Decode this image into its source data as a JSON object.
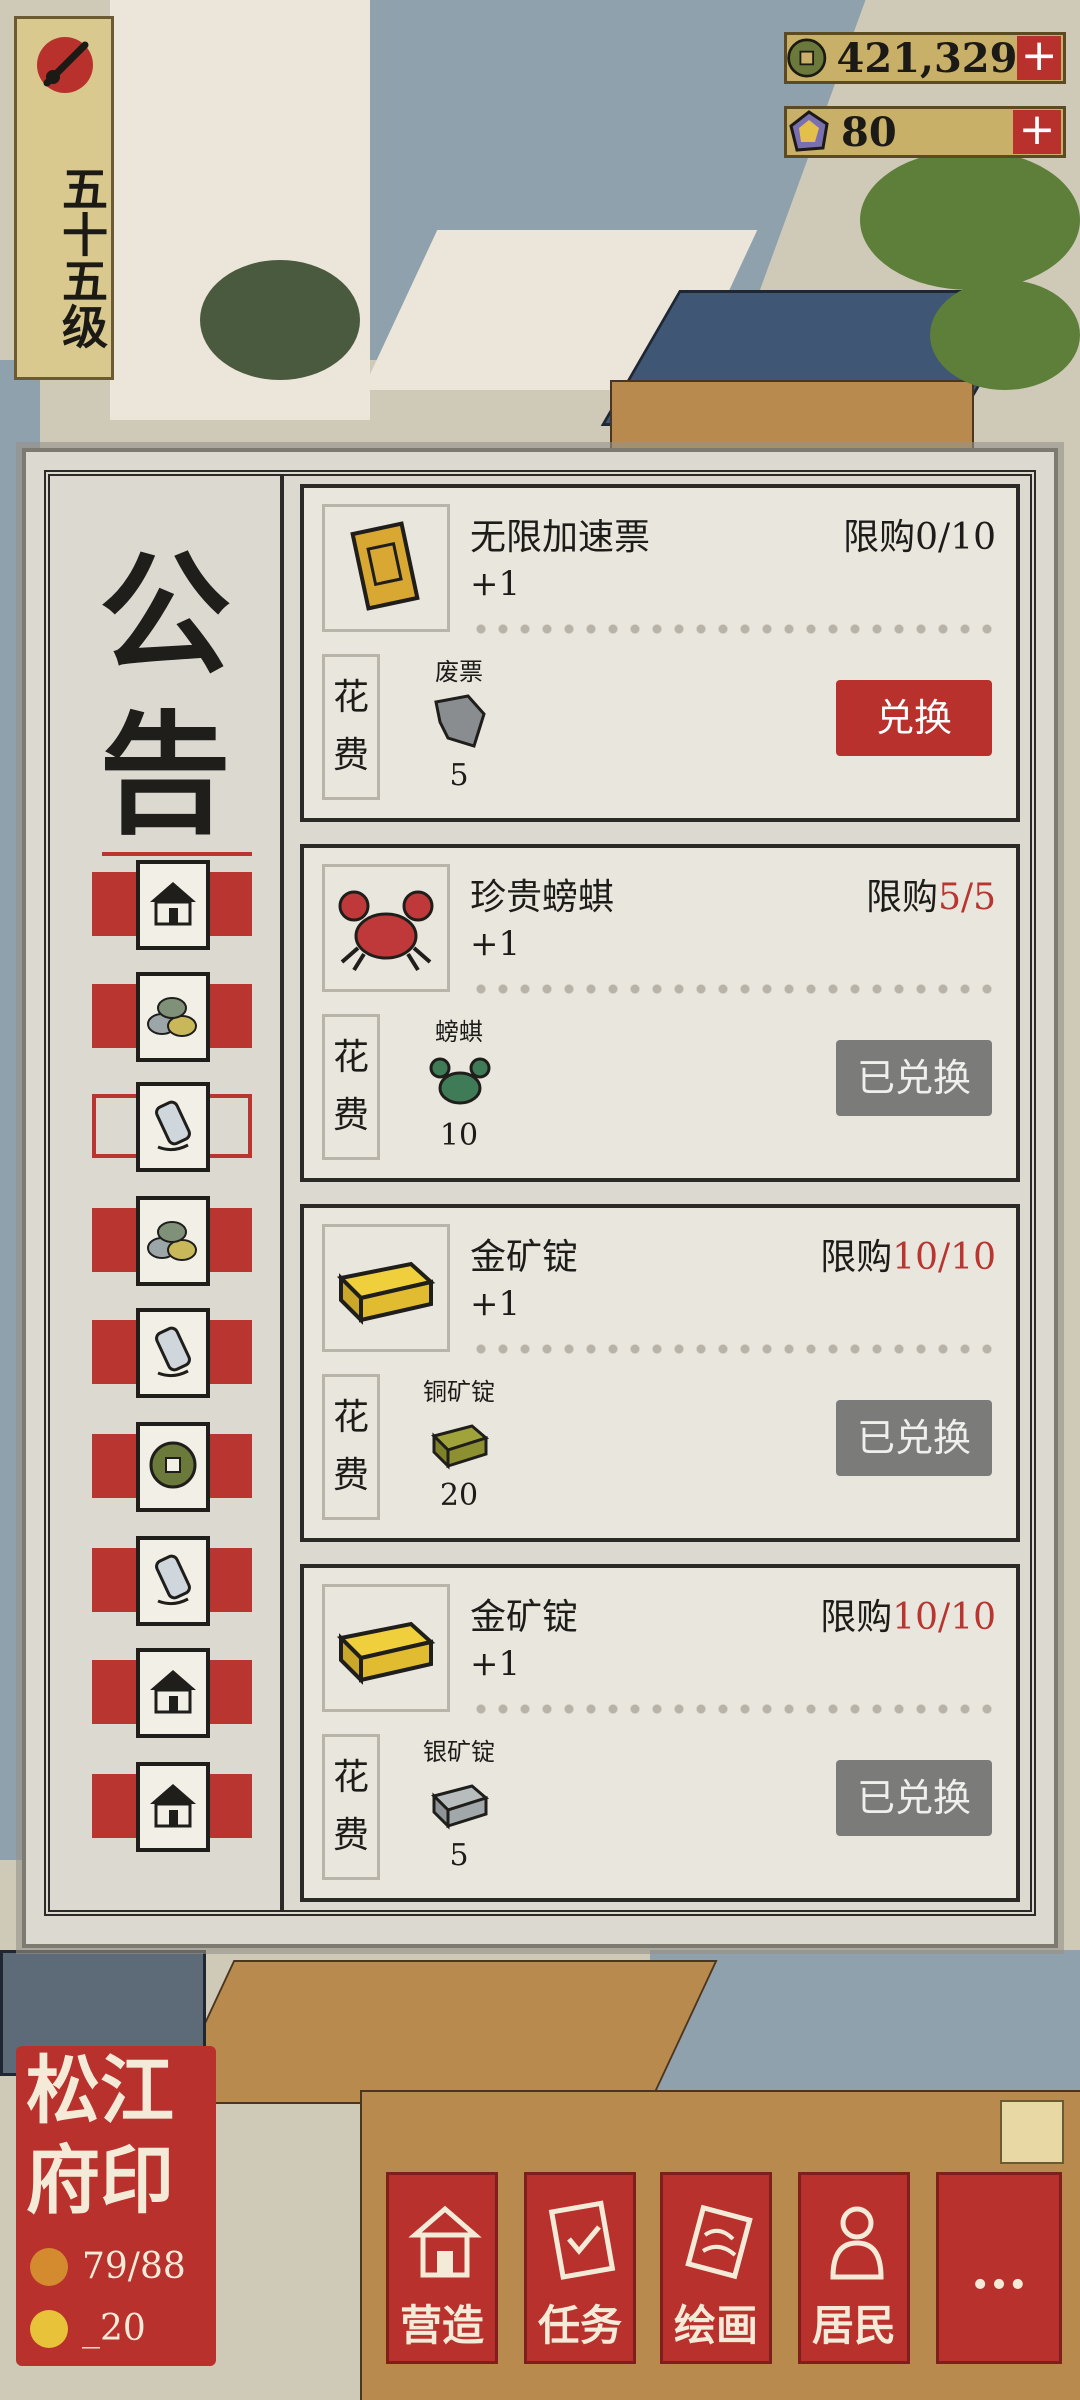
{
  "level": {
    "text": "五十五级"
  },
  "currency": [
    {
      "icon": "coin-icon",
      "value": "421,329"
    },
    {
      "icon": "jade-icon",
      "value": "80"
    }
  ],
  "panel": {
    "title": "公告"
  },
  "tabs": [
    {
      "icon": "house-icon",
      "selected": false
    },
    {
      "icon": "ore-pile-icon",
      "selected": false
    },
    {
      "icon": "bottle-icon",
      "selected": true
    },
    {
      "icon": "ore-pile-icon",
      "selected": false
    },
    {
      "icon": "bottle-icon",
      "selected": false
    },
    {
      "icon": "coin-icon",
      "selected": false
    },
    {
      "icon": "bottle-icon",
      "selected": false
    },
    {
      "icon": "house-icon",
      "selected": false
    },
    {
      "icon": "house-icon",
      "selected": false
    }
  ],
  "items": [
    {
      "name": "无限加速票",
      "amount": "+1",
      "limit_prefix": "限购",
      "limit_count": "0/10",
      "limit_red": false,
      "cost_label": "花费",
      "cost_name": "废票",
      "cost_num": "5",
      "button": "兑换",
      "button_active": true
    },
    {
      "name": "珍贵螃蜞",
      "amount": "+1",
      "limit_prefix": "限购",
      "limit_count": "5/5",
      "limit_red": true,
      "cost_label": "花费",
      "cost_name": "螃蜞",
      "cost_num": "10",
      "button": "已兑换",
      "button_active": false
    },
    {
      "name": "金矿锭",
      "amount": "+1",
      "limit_prefix": "限购",
      "limit_count": "10/10",
      "limit_red": true,
      "cost_label": "花费",
      "cost_name": "铜矿锭",
      "cost_num": "20",
      "button": "已兑换",
      "button_active": false
    },
    {
      "name": "金矿锭",
      "amount": "+1",
      "limit_prefix": "限购",
      "limit_count": "10/10",
      "limit_red": true,
      "cost_label": "花费",
      "cost_name": "银矿锭",
      "cost_num": "5",
      "button": "已兑换",
      "button_active": false
    }
  ],
  "seal": {
    "chars": [
      "松",
      "江",
      "府",
      "印"
    ],
    "population": "79/88",
    "second_stat": "_20"
  },
  "nav": [
    {
      "label": "营造"
    },
    {
      "label": "任务"
    },
    {
      "label": "绘画"
    },
    {
      "label": "居民"
    },
    {
      "label": "..."
    }
  ]
}
